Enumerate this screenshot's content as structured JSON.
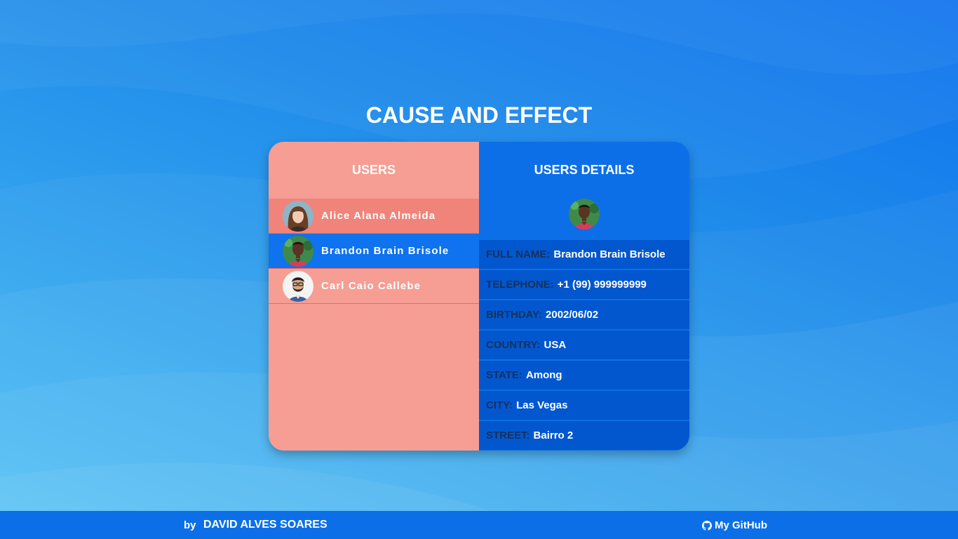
{
  "page": {
    "title": "CAUSE AND EFFECT"
  },
  "colors": {
    "users_panel": "#f69d94",
    "users_hover_row": "#f0847a",
    "selected_row": "#0f72ee",
    "details_panel": "#0d6fe8",
    "details_row": "#0257cf",
    "detail_label": "#17315c"
  },
  "users_panel": {
    "header": "USERS",
    "users": [
      {
        "name": "Alice Alana Almeida",
        "avatar": "female-avatar-icon",
        "state": "hover"
      },
      {
        "name": "Brandon Brain Brisole",
        "avatar": "male-avatar-icon",
        "state": "selected"
      },
      {
        "name": "Carl Caio Callebe",
        "avatar": "male-glasses-avatar-icon",
        "state": "normal"
      }
    ]
  },
  "details_panel": {
    "header": "USERS DETAILS",
    "avatar": "male-avatar-icon",
    "fields": [
      {
        "label": "FULL NAME:",
        "value": "Brandon Brain Brisole"
      },
      {
        "label": "TELEPHONE:",
        "value": "+1 (99) 999999999"
      },
      {
        "label": "BIRTHDAY:",
        "value": "2002/06/02"
      },
      {
        "label": "COUNTRY:",
        "value": "USA"
      },
      {
        "label": "STATE:",
        "value": "Among"
      },
      {
        "label": "CITY:",
        "value": "Las Vegas"
      },
      {
        "label": "STREET:",
        "value": "Bairro 2"
      }
    ]
  },
  "footer": {
    "by_label": "by",
    "author": "DAVID ALVES SOARES",
    "github_label": "My GitHub",
    "github_icon": "github-icon"
  }
}
